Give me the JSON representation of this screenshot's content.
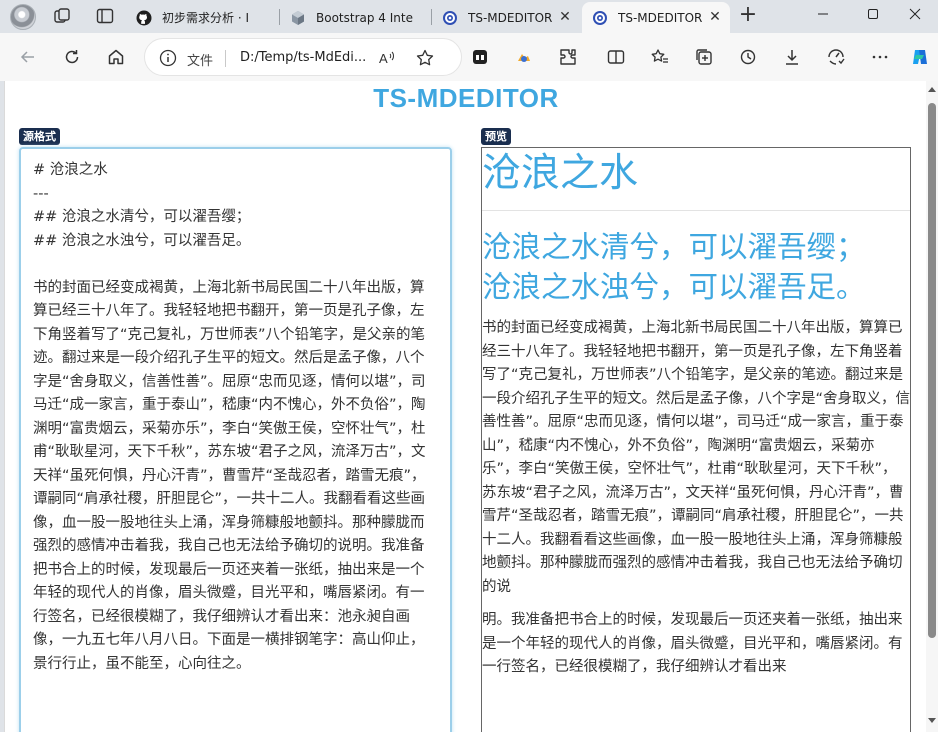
{
  "browser": {
    "tabs": [
      {
        "label": "初步需求分析 · I",
        "icon": "github-icon"
      },
      {
        "label": "Bootstrap 4 Inte",
        "icon": "cube-icon"
      },
      {
        "label": "TS-MDEDITOR",
        "icon": "target-icon"
      },
      {
        "label": "TS-MDEDITOR",
        "icon": "target-icon",
        "active": true
      }
    ],
    "address": {
      "scheme_label": "文件",
      "url": "D:/Temp/ts-MdEdi..."
    },
    "read_aloud_glyph": "A̩"
  },
  "app": {
    "title": "TS-MDEDITOR",
    "source_label": "源格式",
    "preview_label": "预览"
  },
  "editor_lines": [
    "# 沧浪之水",
    "---",
    "## 沧浪之水清兮，可以濯吾缨；",
    "## 沧浪之水浊兮，可以濯吾足。",
    "",
    "书的封面已经变成褐黄，上海北新书局民国二十八年出版，算算已经三十八年了。我轻轻地把书翻开，第一页是孔子像，左下角竖着写了“克己复礼，万世师表”八个铅笔字，是父亲的笔迹。翻过来是一段介绍孔子生平的短文。然后是孟子像，八个字是“舍身取义，信善性善”。屈原“忠而见逐，情何以堪”，司马迁“成一家言，重于泰山”，嵇康“内不愧心，外不负俗”，陶渊明“富贵烟云，采菊亦乐”，李白“笑傲王侯，空怀壮气”，杜甫“耿耿星河，天下千秋”，苏东坡“君子之风，流泽万古”，文天祥“虽死何惧，丹心汗青”，曹雪芹“圣哉忍者，踏雪无痕”，谭嗣同“肩承社稷，肝胆昆仑”，一共十二人。我翻看看这些画像，血一股一股地往头上涌，浑身筛糠般地颤抖。那种朦胧而强烈的感情冲击着我，我自己也无法给予确切的说明。我准备把书合上的时候，发现最后一页还夹着一张纸，抽出来是一个年轻的现代人的肖像，眉头微蹙，目光平和，嘴唇紧闭。有一行签名，已经很模糊了，我仔细辨认才看出来：池永昶自画像，一九五七年八月八日。下面是一横排钢笔字：高山仰止，景行行止，虽不能至，心向往之。"
  ],
  "preview": {
    "h1": "沧浪之水",
    "h2_lines": [
      "沧浪之水清兮，可以濯吾缨；",
      "沧浪之水浊兮，可以濯吾足。"
    ],
    "p1": "书的封面已经变成褐黄，上海北新书局民国二十八年出版，算算已经三十八年了。我轻轻地把书翻开，第一页是孔子像，左下角竖着写了“克己复礼，万世师表”八个铅笔字，是父亲的笔迹。翻过来是一段介绍孔子生平的短文。然后是孟子像，八个字是“舍身取义，信善性善”。屈原“忠而见逐，情何以堪”，司马迁“成一家言，重于泰山”，嵇康“内不愧心，外不负俗”，陶渊明“富贵烟云，采菊亦乐”，李白“笑傲王侯，空怀壮气”，杜甫“耿耿星河，天下千秋”，苏东坡“君子之风，流泽万古”，文天祥“虽死何惧，丹心汗青”，曹雪芹“圣哉忍者，踏雪无痕”，谭嗣同“肩承社稷，肝胆昆仑”，一共十二人。我翻看看这些画像，血一股一股地往头上涌，浑身筛糠般地颤抖。那种朦胧而强烈的感情冲击着我，我自己也无法给予确切的说",
    "p2": "明。我准备把书合上的时候，发现最后一页还夹着一张纸，抽出来是一个年轻的现代人的肖像，眉头微蹙，目光平和，嘴唇紧闭。有一行签名，已经很模糊了，我仔细辨认才看出来"
  },
  "colors": {
    "accent": "#3fa7e0",
    "badge": "#1a2e4f"
  }
}
